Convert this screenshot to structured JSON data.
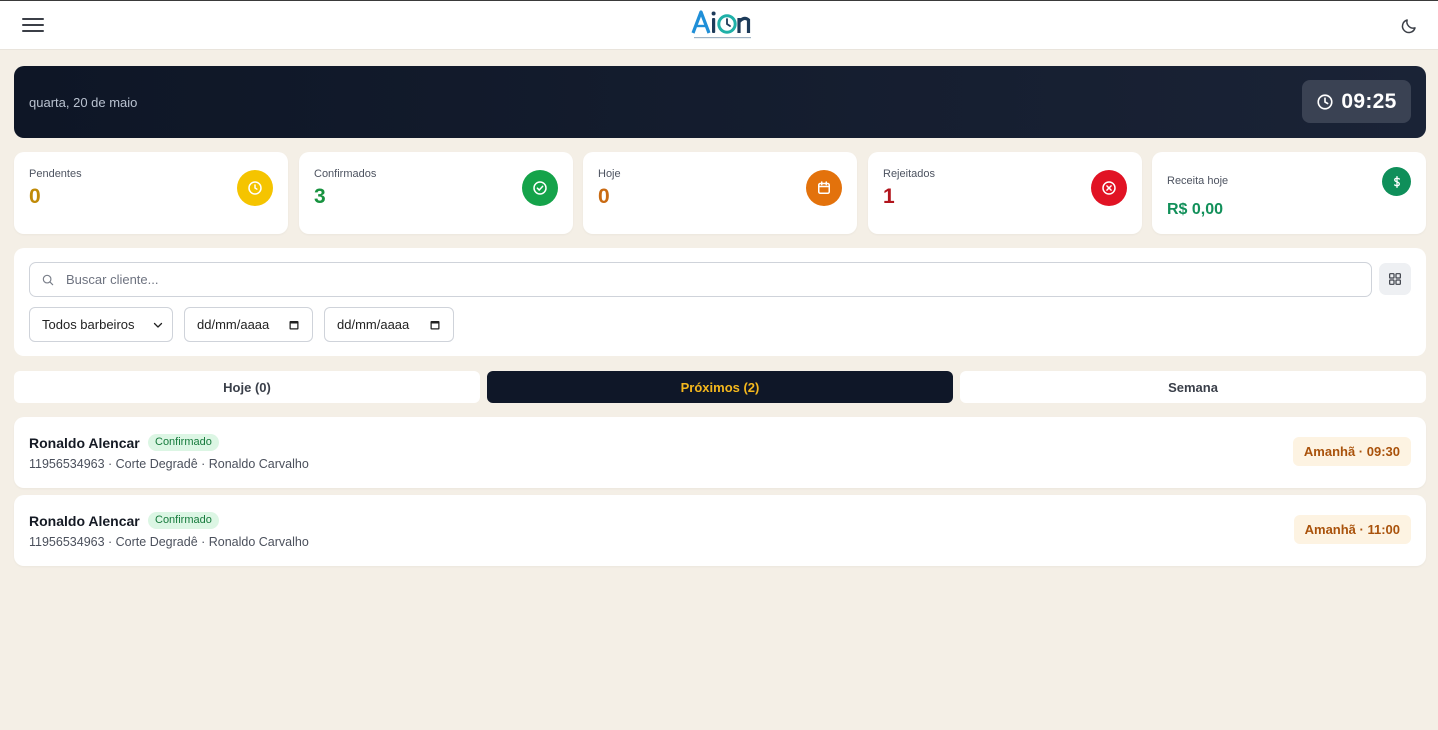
{
  "header": {
    "logo_text": "Aion",
    "menu_icon": "hamburger-icon",
    "theme_icon": "moon-icon"
  },
  "hero": {
    "date": "quarta, 20 de maio",
    "time": "09:25",
    "clock_icon": "clock-icon"
  },
  "stats": [
    {
      "label": "Pendentes",
      "value": "0",
      "color": "#c08a07",
      "icon_bg": "#f5c400",
      "icon": "clock-icon"
    },
    {
      "label": "Confirmados",
      "value": "3",
      "color": "#17923f",
      "icon_bg": "#15a34a",
      "icon": "check-circle-icon"
    },
    {
      "label": "Hoje",
      "value": "0",
      "color": "#c96a12",
      "icon_bg": "#e3720c",
      "icon": "calendar-icon"
    },
    {
      "label": "Rejeitados",
      "value": "1",
      "color": "#b1141c",
      "icon_bg": "#e11324",
      "icon": "x-circle-icon"
    },
    {
      "label": "Receita hoje",
      "value": "R$ 0,00",
      "color": "#12905a",
      "icon_bg": "#0f8f5a",
      "icon": "dollar-icon"
    }
  ],
  "filters": {
    "search_placeholder": "Buscar cliente...",
    "barber_select": "Todos barbeiros",
    "date_from": "dd/mm/aaaa",
    "date_to": "dd/mm/aaaa"
  },
  "tabs": [
    {
      "label": "Hoje (0)",
      "active": false
    },
    {
      "label": "Próximos (2)",
      "active": true
    },
    {
      "label": "Semana",
      "active": false
    }
  ],
  "appointments": [
    {
      "name": "Ronaldo Alencar",
      "status": "Confirmado",
      "details": "11956534963 · Corte Degradê · Ronaldo Carvalho",
      "when": "Amanhã · 09:30"
    },
    {
      "name": "Ronaldo Alencar",
      "status": "Confirmado",
      "details": "11956534963 · Corte Degradê · Ronaldo Carvalho",
      "when": "Amanhã · 11:00"
    }
  ],
  "colors": {
    "background": "#f4efe6",
    "hero_bg": "#0e1626",
    "active_tab_bg": "#0f1728",
    "active_tab_text": "#f5b81d"
  }
}
